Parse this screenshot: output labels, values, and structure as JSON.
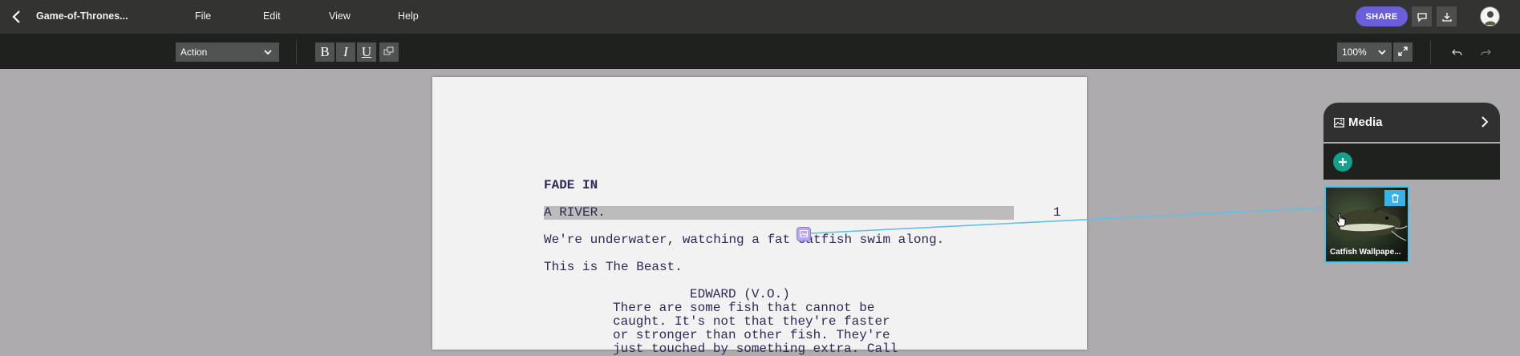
{
  "header": {
    "doc_title": "Game-of-Thrones...",
    "menu": [
      "File",
      "Edit",
      "View",
      "Help"
    ],
    "share_label": "SHARE",
    "icons": [
      "back-chevron-icon",
      "comment-icon",
      "download-icon",
      "avatar"
    ]
  },
  "toolbar": {
    "element_style": "Action",
    "format_buttons": [
      "B",
      "I",
      "U"
    ],
    "zoom": "100%",
    "icons": [
      "bold-icon",
      "italic-icon",
      "underline-icon",
      "dual-dialogue-icon",
      "fullscreen-icon",
      "undo-icon",
      "redo-icon"
    ]
  },
  "script": {
    "transition": "FADE IN",
    "scene_heading": "A RIVER.",
    "scene_number": "1",
    "action_1": "We're underwater, watching a fat catfish swim along.",
    "action_2": "This is The Beast.",
    "character": "EDWARD (V.O.)",
    "dialogue": [
      "There are some fish that cannot be",
      "caught. It's not that they're faster",
      "or stronger than other fish. They're",
      "just touched by something extra. Call"
    ]
  },
  "media": {
    "title": "Media",
    "items": [
      {
        "caption": "Catfish Wallpape..."
      }
    ]
  },
  "colors": {
    "accent": "#6a5ed9",
    "add_button": "#14a08c",
    "link_line": "#43c6ee",
    "script_text": "#2d2a55"
  }
}
